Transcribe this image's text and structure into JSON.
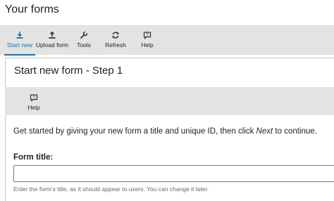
{
  "page": {
    "title": "Your forms"
  },
  "toolbar": {
    "items": [
      {
        "label": "Start new",
        "icon": "download-icon",
        "active": true
      },
      {
        "label": "Upload form",
        "icon": "upload-icon",
        "active": false
      },
      {
        "label": "Tools",
        "icon": "wrench-icon",
        "active": false
      },
      {
        "label": "Refresh",
        "icon": "refresh-icon",
        "active": false
      },
      {
        "label": "Help",
        "icon": "help-icon",
        "active": false
      }
    ]
  },
  "panel": {
    "title": "Start new form - Step 1",
    "subtoolbar": {
      "help_label": "Help",
      "icon": "help-icon"
    },
    "intro_before": "Get started by giving your new form a title and unique ID, then click ",
    "intro_emphasis": "Next",
    "intro_after": " to continue.",
    "form_title_label": "Form title:",
    "form_title_value": "",
    "form_title_hint": "Enter the form's title, as it should appear to users. You can change it later."
  },
  "colors": {
    "accent": "#1d6fa8",
    "toolbar_bg": "#e3e3e3",
    "input_border": "#2f8ec9"
  }
}
